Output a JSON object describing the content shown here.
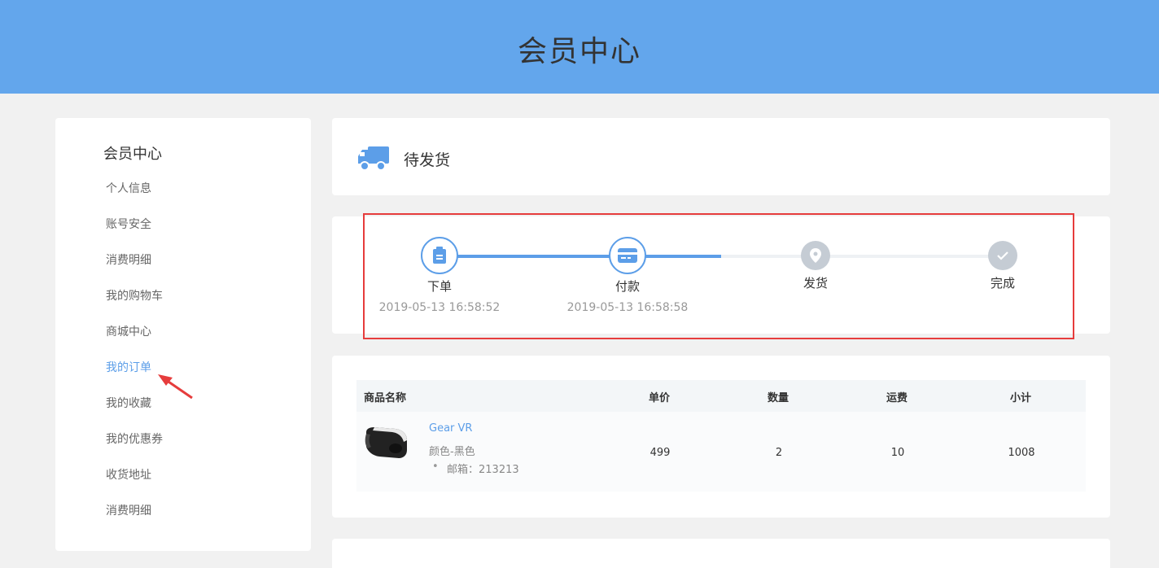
{
  "header": {
    "title": "会员中心"
  },
  "sidebar": {
    "title": "会员中心",
    "items": [
      {
        "label": "个人信息"
      },
      {
        "label": "账号安全"
      },
      {
        "label": "消费明细"
      },
      {
        "label": "我的购物车"
      },
      {
        "label": "商城中心"
      },
      {
        "label": "我的订单",
        "active": true
      },
      {
        "label": "我的收藏"
      },
      {
        "label": "我的优惠券"
      },
      {
        "label": "收货地址"
      },
      {
        "label": "消费明细"
      }
    ]
  },
  "order_status": {
    "label": "待发货",
    "icon": "truck-icon"
  },
  "progress": {
    "steps": [
      {
        "label": "下单",
        "time": "2019-05-13 16:58:52",
        "icon": "clipboard-icon",
        "done": true
      },
      {
        "label": "付款",
        "time": "2019-05-13 16:58:58",
        "icon": "card-icon",
        "done": true
      },
      {
        "label": "发货",
        "time": "",
        "icon": "location-pin-icon",
        "done": false
      },
      {
        "label": "完成",
        "time": "",
        "icon": "check-icon",
        "done": false
      }
    ]
  },
  "order_table": {
    "headers": {
      "name": "商品名称",
      "price": "单价",
      "qty": "数量",
      "shipping": "运费",
      "subtotal": "小计"
    },
    "rows": [
      {
        "name": "Gear VR",
        "spec": "颜色-黑色",
        "extra": "邮箱：213213",
        "price": "499",
        "qty": "2",
        "shipping": "10",
        "subtotal": "1008"
      }
    ]
  },
  "colors": {
    "header_bg": "#63a6ec",
    "accent": "#5c9ee8",
    "highlight": "#e63c3c"
  }
}
